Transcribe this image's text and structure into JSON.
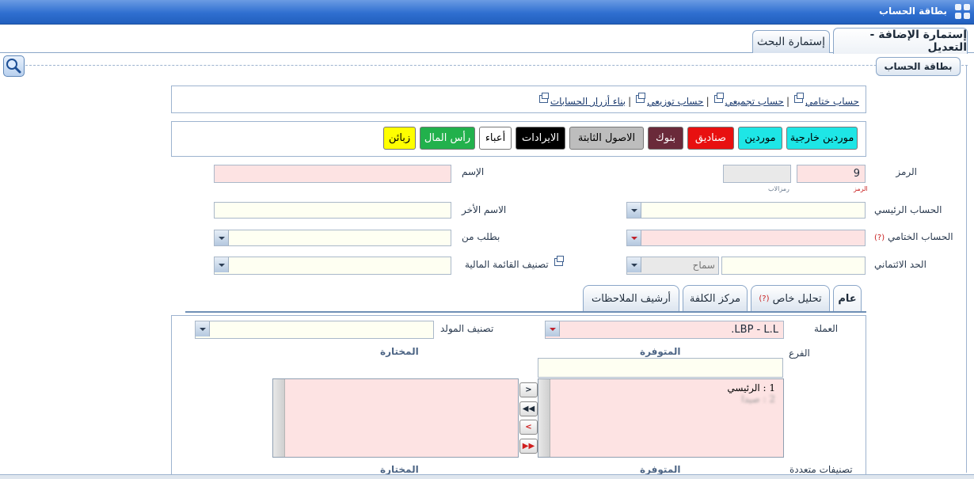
{
  "window": {
    "title": "بطاقة الحساب"
  },
  "tabs": {
    "add_edit": "إستمارة الإضافة - التعديل",
    "search": "إستمارة البحث"
  },
  "section": {
    "title": "بطاقة الحساب"
  },
  "links": {
    "final_account": "حساب ختامي",
    "aggregate_account": "حساب تجميعي",
    "distribution_account": "حساب توزيعي",
    "build_buttons": "بناء أزرار الحسابات"
  },
  "type_buttons": [
    {
      "label": "موردين خارجية",
      "bg": "#1ee6e6",
      "color": "#000000"
    },
    {
      "label": "موردين",
      "bg": "#1ee6e6",
      "color": "#000000"
    },
    {
      "label": "صناديق",
      "bg": "#e81010",
      "color": "#ffffff"
    },
    {
      "label": "بنوك",
      "bg": "#6a2a3a",
      "color": "#ffffff"
    },
    {
      "label": "الاصول الثابتة",
      "bg": "#bdbdbd",
      "color": "#000000"
    },
    {
      "label": "الايرادات",
      "bg": "#000000",
      "color": "#ffffff"
    },
    {
      "label": "أعباء",
      "bg": "#ffffff",
      "color": "#000000"
    },
    {
      "label": "رأس المال",
      "bg": "#22b14c",
      "color": "#ffffff"
    },
    {
      "label": "زبائن",
      "bg": "#ffff00",
      "color": "#000000"
    }
  ],
  "form": {
    "code_label": "الرمز",
    "code_value": "9",
    "code_caption": "الرمز",
    "parent_code_caption": "رمزالاب",
    "name_label": "الإسم",
    "name_value": "",
    "main_account_label": "الحساب الرئيسي",
    "other_name_label": "الاسم الأخر",
    "final_account_label": "الحساب الختامي",
    "final_account_q": "(?)",
    "request_from_label": "بطلب من",
    "credit_limit_label": "الحد الائتماني",
    "credit_type": "سماح",
    "fin_statement_label": "تصنيف القائمة المالية"
  },
  "subtabs": {
    "general": "عام",
    "special_analysis": "تحليل خاص",
    "special_analysis_q": "(?)",
    "cost_center": "مركز الكلفة",
    "notes_archive": "أرشيف الملاحظات"
  },
  "general": {
    "currency_label": "العملة",
    "currency_value": "LBP - L.L.",
    "generator_class_label": "تصنيف المولد",
    "branch_label": "الفرع",
    "available_label": "المتوفرة",
    "selected_label": "المختارة",
    "available_items": [
      "1 : الرئيسي",
      "2 : صيدا"
    ],
    "multi_class_label": "تصنيفات متعددة",
    "available_label2": "المتوفرة",
    "selected_label2": "المختارة"
  }
}
